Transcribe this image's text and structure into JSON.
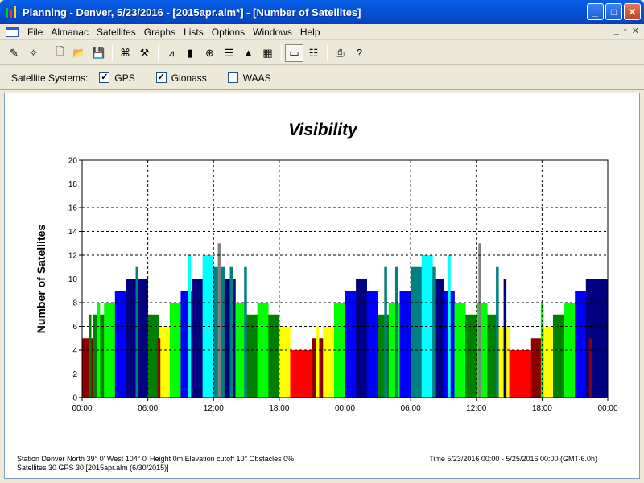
{
  "window": {
    "title": "Planning - Denver, 5/23/2016 - [2015apr.alm*] - [Number of Satellites]",
    "buttons": {
      "minimize": "_",
      "maximize": "□",
      "close": "✕"
    }
  },
  "menu": {
    "items": [
      "File",
      "Almanac",
      "Satellites",
      "Graphs",
      "Lists",
      "Options",
      "Windows",
      "Help"
    ],
    "mdi": {
      "minimize": "_",
      "restore": "▫",
      "close": "✕"
    }
  },
  "toolbar": {
    "icons": [
      {
        "name": "station-icon",
        "glyph": "✎"
      },
      {
        "name": "satellite-icon",
        "glyph": "✧"
      },
      {
        "sep": true
      },
      {
        "name": "new-icon",
        "glyph": "🗋"
      },
      {
        "name": "open-icon",
        "glyph": "📂"
      },
      {
        "name": "save-icon",
        "glyph": "💾"
      },
      {
        "sep": true
      },
      {
        "name": "obstacles-icon",
        "glyph": "⌘"
      },
      {
        "name": "almanac-icon",
        "glyph": "⚒"
      },
      {
        "sep": true
      },
      {
        "name": "elevation-icon",
        "glyph": "⩘"
      },
      {
        "name": "satellites-bar-icon",
        "glyph": "▮"
      },
      {
        "name": "skyplot-icon",
        "glyph": "⊕"
      },
      {
        "name": "visibility-icon",
        "glyph": "☰"
      },
      {
        "name": "dop-icon",
        "glyph": "▲"
      },
      {
        "name": "world-icon",
        "glyph": "▦"
      },
      {
        "sep": true
      },
      {
        "name": "chart-view-icon",
        "glyph": "▭",
        "pressed": true
      },
      {
        "name": "legend-icon",
        "glyph": "☷"
      },
      {
        "sep": true
      },
      {
        "name": "print-icon",
        "glyph": "⎙"
      },
      {
        "name": "help-icon",
        "glyph": "?"
      }
    ]
  },
  "options": {
    "label": "Satellite Systems:",
    "systems": [
      {
        "name": "GPS",
        "checked": true
      },
      {
        "name": "Glonass",
        "checked": true
      },
      {
        "name": "WAAS",
        "checked": false
      }
    ]
  },
  "chart_data": {
    "type": "bar",
    "title": "Visibility",
    "ylabel": "Number of Satellites",
    "xlabel": "",
    "ylim": [
      0,
      20
    ],
    "yticks": [
      0,
      2,
      4,
      6,
      8,
      10,
      12,
      14,
      16,
      18,
      20
    ],
    "xlim": [
      0,
      48
    ],
    "xticks": [
      "00:00",
      "06:00",
      "12:00",
      "18:00",
      "00:00",
      "06:00",
      "12:00",
      "18:00",
      "00:00"
    ],
    "grid": true,
    "color_scale": {
      "4": "#ff0000",
      "5": "#8b0000",
      "6": "#ffff00",
      "7": "#008000",
      "8": "#00ff00",
      "9": "#0000ff",
      "10": "#000080",
      "11": "#008080",
      "12": "#00ffff",
      "13": "#808080"
    },
    "hour_values": [
      5,
      7,
      8,
      9,
      10,
      10,
      7,
      6,
      8,
      9,
      10,
      12,
      11,
      10,
      8,
      7,
      8,
      7,
      6,
      4,
      4,
      5,
      6,
      8,
      9,
      10,
      9,
      7,
      8,
      9,
      11,
      12,
      10,
      9,
      8,
      7,
      8,
      7,
      6,
      4,
      4,
      5,
      6,
      7,
      8,
      9,
      10,
      10
    ],
    "spikes": [
      {
        "x": 0.7,
        "v": 7
      },
      {
        "x": 1.5,
        "v": 8
      },
      {
        "x": 5.0,
        "v": 11
      },
      {
        "x": 7.0,
        "v": 5
      },
      {
        "x": 9.8,
        "v": 12
      },
      {
        "x": 12.5,
        "v": 13
      },
      {
        "x": 13.6,
        "v": 11
      },
      {
        "x": 14.9,
        "v": 11
      },
      {
        "x": 21.5,
        "v": 6
      },
      {
        "x": 27.7,
        "v": 11
      },
      {
        "x": 28.7,
        "v": 11
      },
      {
        "x": 32.1,
        "v": 11
      },
      {
        "x": 33.5,
        "v": 12
      },
      {
        "x": 36.3,
        "v": 13
      },
      {
        "x": 37.9,
        "v": 11
      },
      {
        "x": 38.6,
        "v": 10
      },
      {
        "x": 42.0,
        "v": 8
      },
      {
        "x": 46.4,
        "v": 5
      }
    ]
  },
  "footer": {
    "line1": "Station Denver   North 39° 0'   West 104° 0'   Height 0m      Elevation cutoff 10°  Obstacles 0%",
    "line2": "Satellites 30   GPS 30   [2015apr.alm (6/30/2015)]",
    "time": "Time 5/23/2016 00:00 -   5/25/2016 00:00 (GMT-6.0h)"
  }
}
